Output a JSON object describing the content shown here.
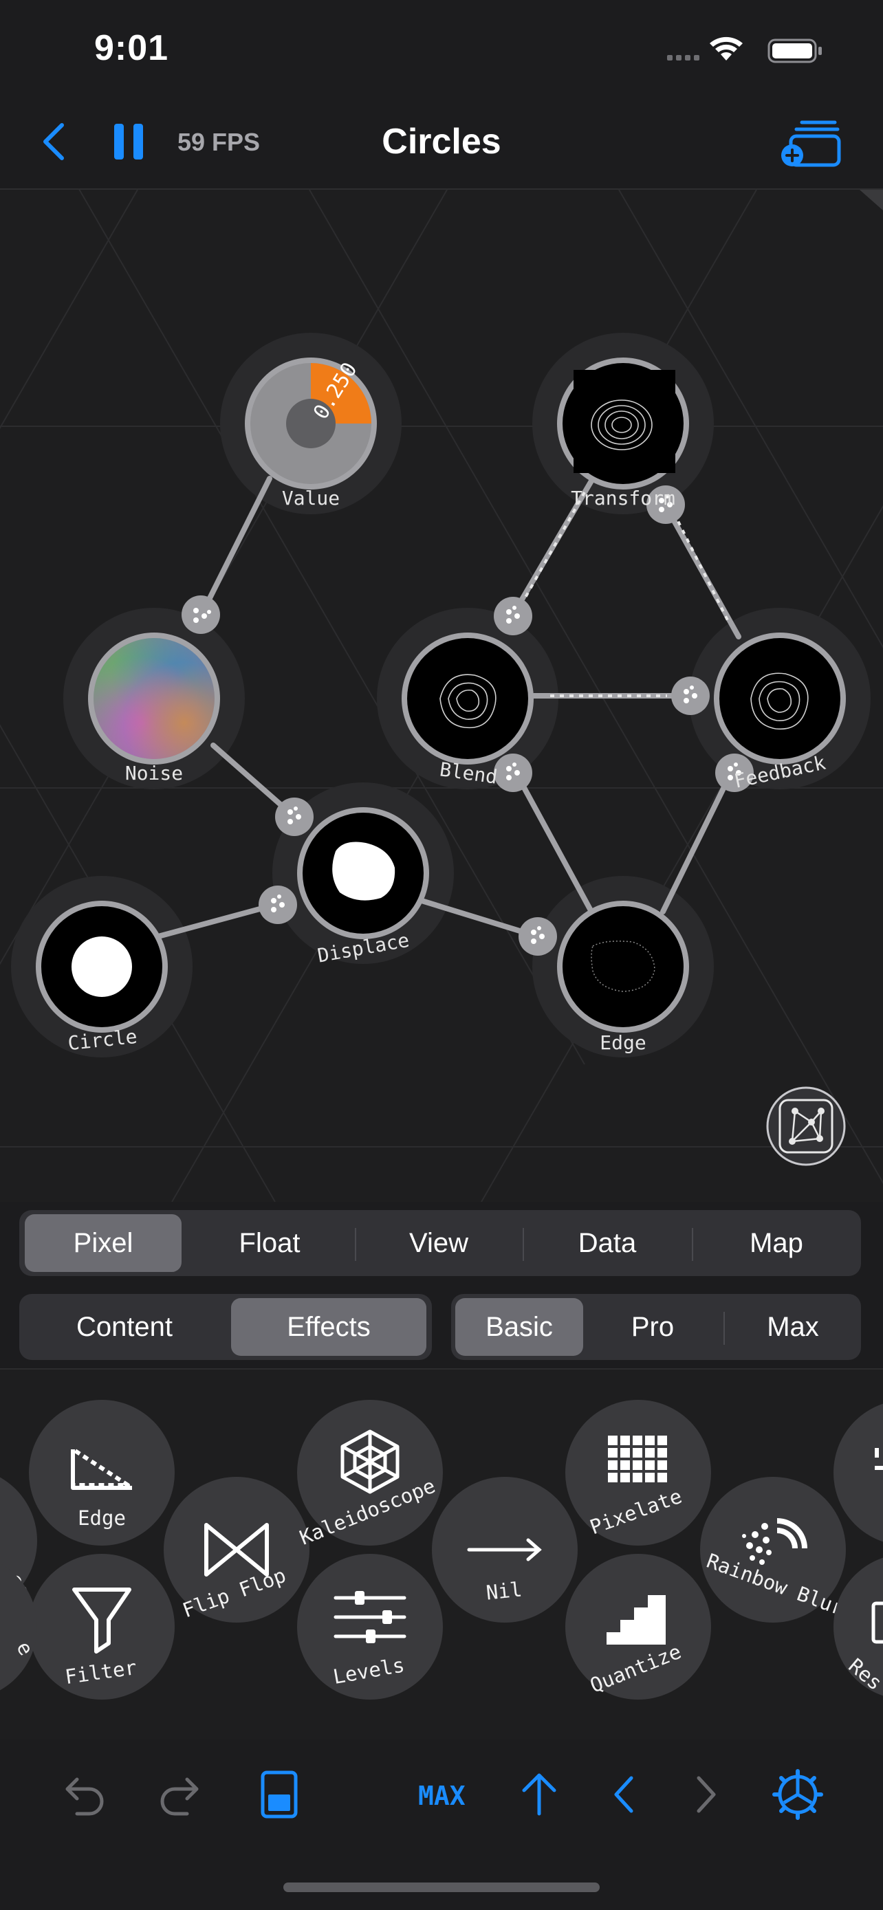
{
  "status_bar": {
    "time": "9:01"
  },
  "nav": {
    "fps": "59 FPS",
    "title": "Circles"
  },
  "graph": {
    "nodes": {
      "value": {
        "label": "Value",
        "readout": "0.250"
      },
      "transform": {
        "label": "Transform"
      },
      "noise": {
        "label": "Noise"
      },
      "blend": {
        "label": "Blend"
      },
      "feedback": {
        "label": "Feedback"
      },
      "displace": {
        "label": "Displace"
      },
      "circle": {
        "label": "Circle"
      },
      "edge": {
        "label": "Edge"
      }
    }
  },
  "categories": {
    "tabs": [
      "Pixel",
      "Float",
      "View",
      "Data",
      "Map"
    ],
    "selected": "Pixel"
  },
  "kinds": {
    "tabs": [
      "Content",
      "Effects"
    ],
    "selected": "Effects"
  },
  "levels": {
    "tabs": [
      "Basic",
      "Pro",
      "Max"
    ],
    "selected": "Basic"
  },
  "palette": {
    "items": [
      "Edge",
      "Filter",
      "Flip Flop",
      "Kaleidoscope",
      "Levels",
      "Nil",
      "Pixelate",
      "Quantize",
      "Rainbow Blur"
    ],
    "partial_left": [
      "ce",
      "e"
    ],
    "partial_right": [
      "Res"
    ]
  },
  "toolbar": {
    "max_label": "MAX"
  },
  "colors": {
    "accent": "#1a8cff",
    "value_orange": "#f07c18",
    "background": "#1c1c1e"
  }
}
